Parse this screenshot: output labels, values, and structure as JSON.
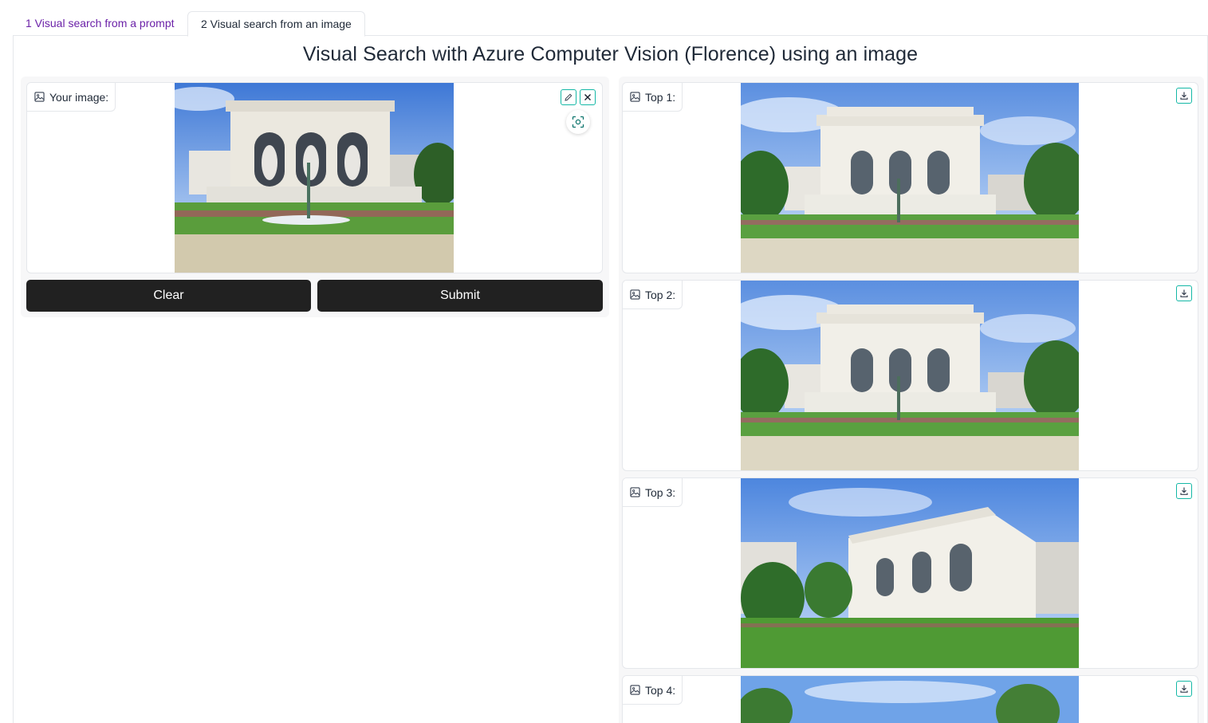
{
  "tabs": [
    {
      "label": "1 Visual search from a prompt",
      "active": false
    },
    {
      "label": "2 Visual search from an image",
      "active": true
    }
  ],
  "page_title": "Visual Search with Azure Computer Vision (Florence) using an image",
  "input_image": {
    "label": "Your image:",
    "icon": "image-icon",
    "actions": [
      "pencil-icon",
      "close-icon",
      "focus-icon"
    ]
  },
  "buttons": {
    "clear": "Clear",
    "submit": "Submit"
  },
  "results": [
    {
      "label": "Top 1:",
      "icon": "image-icon",
      "action": "download-icon"
    },
    {
      "label": "Top 2:",
      "icon": "image-icon",
      "action": "download-icon"
    },
    {
      "label": "Top 3:",
      "icon": "image-icon",
      "action": "download-icon"
    },
    {
      "label": "Top 4:",
      "icon": "image-icon",
      "action": "download-icon"
    }
  ],
  "colors": {
    "accent": "#14b8a6",
    "button_bg": "#212121",
    "inactive_tab": "#6b21a8",
    "panel_bg": "#f7f7f8",
    "border": "#e5e7eb"
  }
}
